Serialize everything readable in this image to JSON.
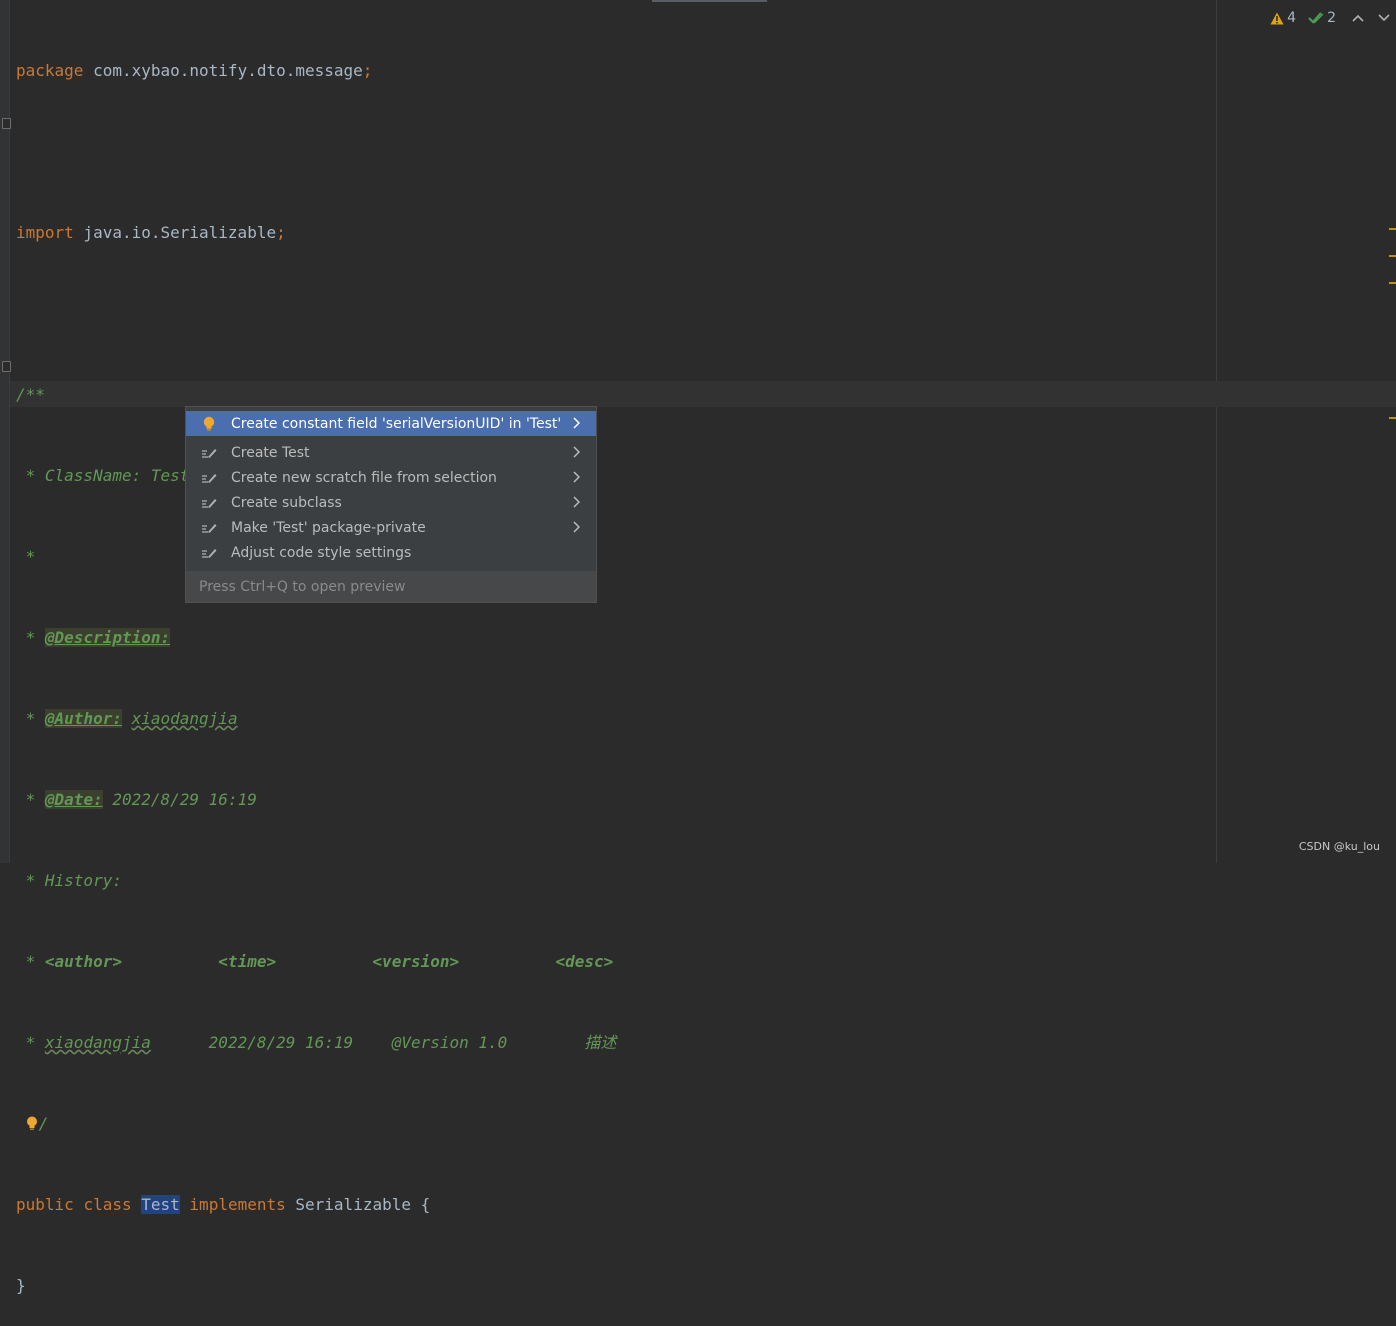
{
  "code": {
    "package_kw": "package",
    "package_name": " com.xybao.notify.dto.message",
    "import_kw": "import",
    "import_name": " java.io.Serializable",
    "semicolon": ";",
    "doc_open": "/**",
    "doc_classname": " * ClassName: Test",
    "doc_star": " *",
    "doc_star_prefix": " * ",
    "tag_description": "@Description:",
    "tag_author": "@Author:",
    "author_name": "xiaodangjia",
    "tag_date": "@Date:",
    "date_value": " 2022/8/29 16:19",
    "doc_history": " * History:",
    "hist_author": "<author>",
    "hist_time": "<time>",
    "hist_version": "<version>",
    "hist_desc": "<desc>",
    "row_author": "xiaodangjia",
    "row_date": "2022/8/29 16:19",
    "row_version": "@Version 1.0",
    "row_desc": "描述",
    "doc_close": "/",
    "public_kw": "public",
    "class_kw": "class",
    "class_name": "Test",
    "implements_kw": "implements",
    "interface_name": "Serializable",
    "brace_open": "{",
    "brace_close": "}"
  },
  "inspections": {
    "warnings_count": "4",
    "weak_warnings_count": "2",
    "warning_color": "#e2a40e",
    "ok_color": "#499c54"
  },
  "popup": {
    "items": [
      {
        "label": "Create constant field 'serialVersionUID' in 'Test'",
        "icon": "lightbulb-icon",
        "submenu": true
      },
      {
        "label": "Create Test",
        "icon": "edit-icon",
        "submenu": true
      },
      {
        "label": "Create new scratch file from selection",
        "icon": "edit-icon",
        "submenu": true
      },
      {
        "label": "Create subclass",
        "icon": "edit-icon",
        "submenu": true
      },
      {
        "label": "Make 'Test' package-private",
        "icon": "edit-icon",
        "submenu": true
      },
      {
        "label": "Adjust code style settings",
        "icon": "edit-icon",
        "submenu": false
      }
    ],
    "footer": "Press Ctrl+Q to open preview",
    "selected_color": "#4b6eaf"
  },
  "watermark": "CSDN @ku_lou"
}
